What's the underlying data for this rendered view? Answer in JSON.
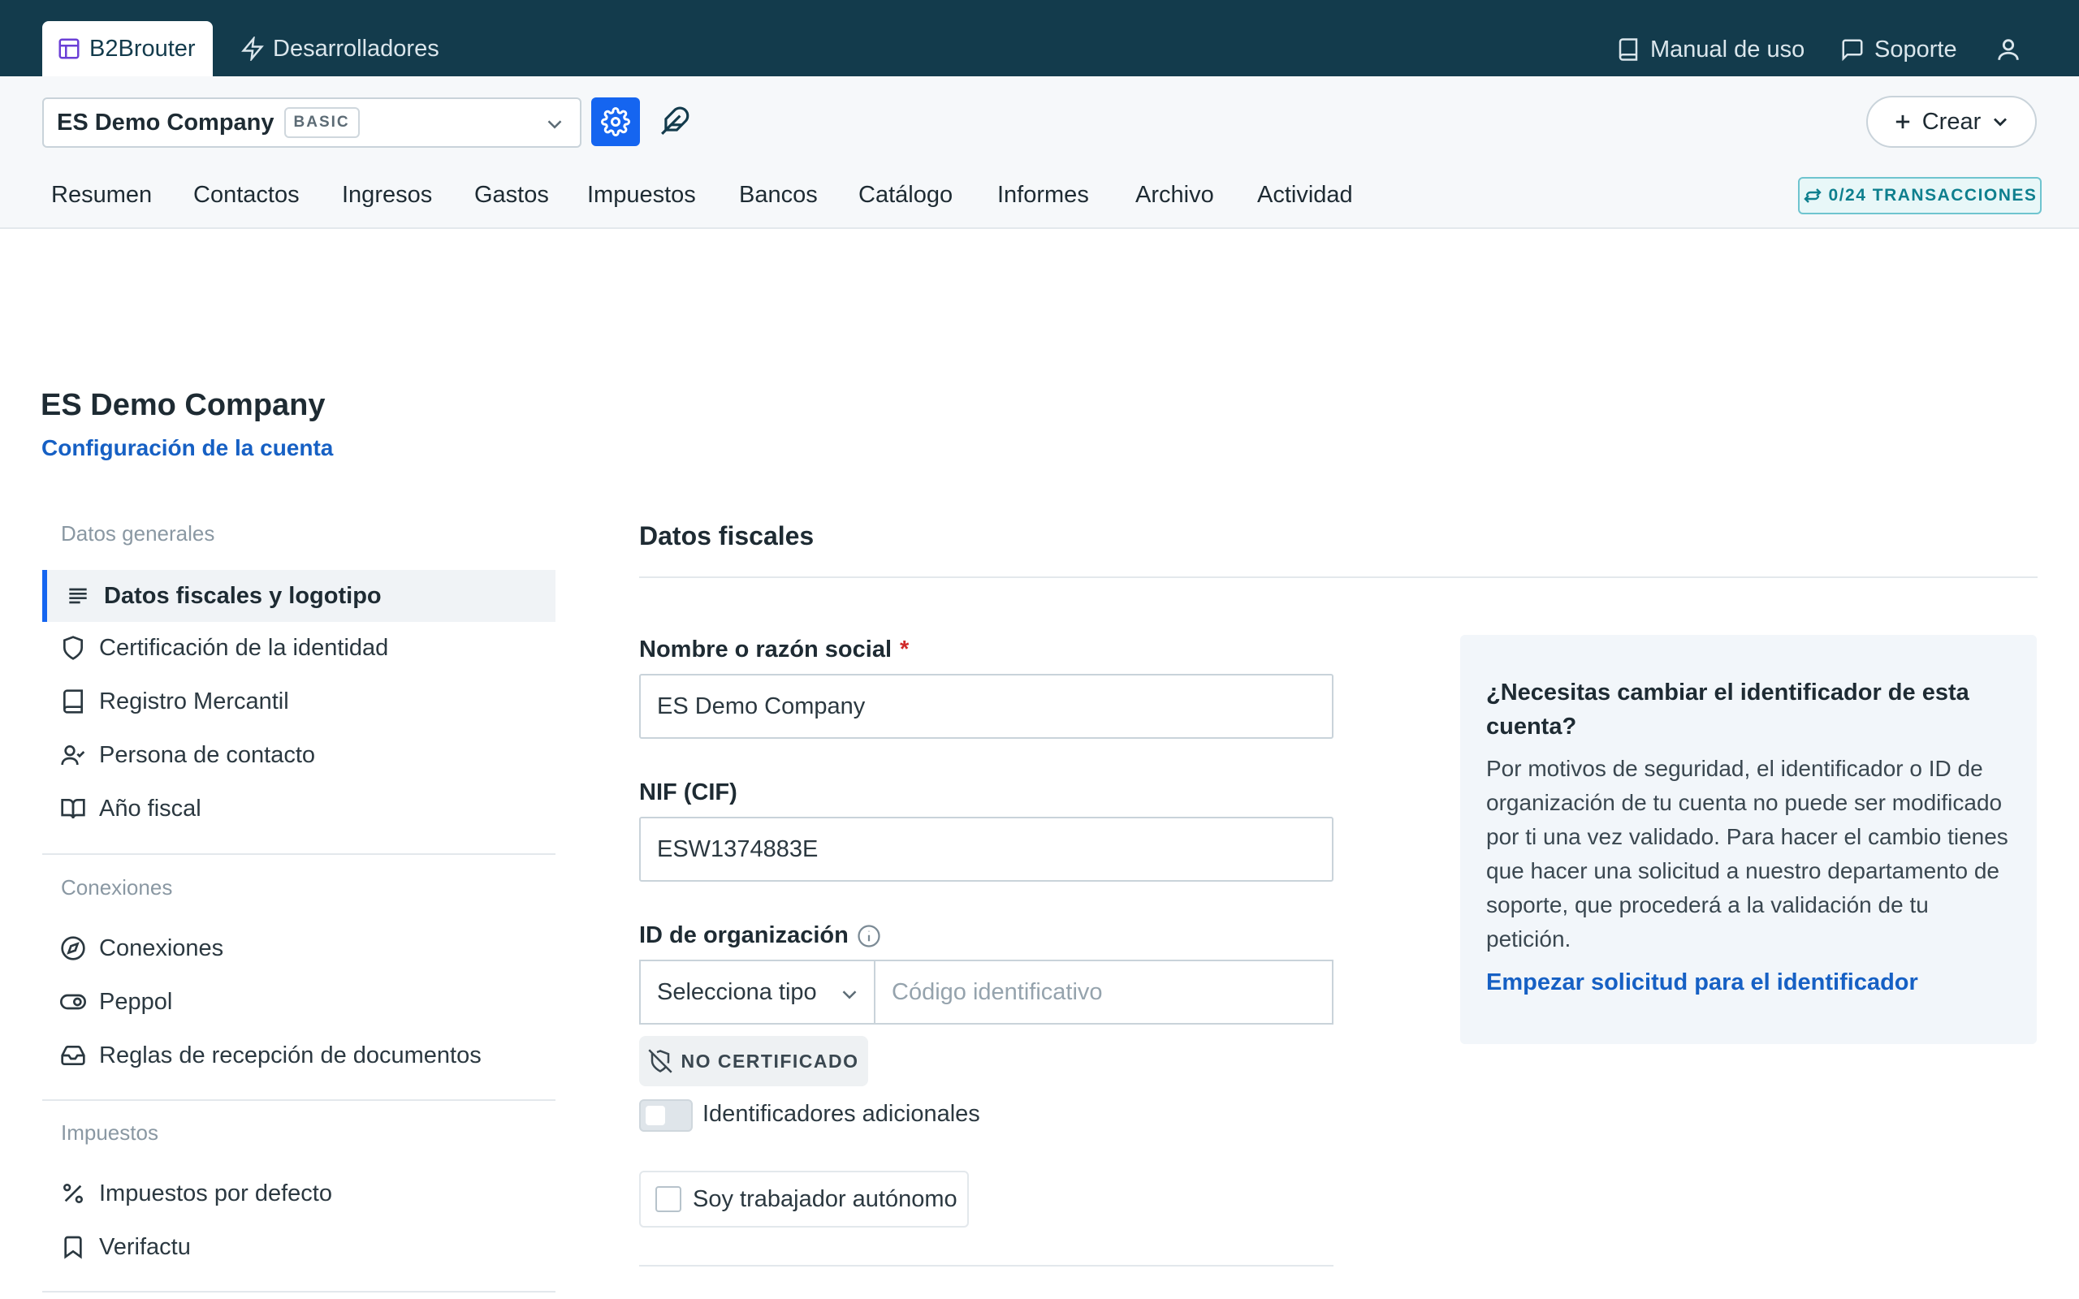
{
  "topbar": {
    "app_tab": "B2Brouter",
    "dev_tab": "Desarrolladores",
    "manual": "Manual de uso",
    "support": "Soporte"
  },
  "subbar": {
    "company_name": "ES Demo Company",
    "plan_badge": "BASIC",
    "crear_label": "Crear",
    "transactions_badge": "0/24 TRANSACCIONES",
    "nav": [
      "Resumen",
      "Contactos",
      "Ingresos",
      "Gastos",
      "Impuestos",
      "Bancos",
      "Catálogo",
      "Informes",
      "Archivo",
      "Actividad"
    ]
  },
  "page": {
    "title": "ES Demo Company",
    "subtitle": "Configuración de la cuenta"
  },
  "sidebar": {
    "sections": [
      {
        "heading": "Datos generales",
        "items": [
          {
            "label": "Datos fiscales y logotipo",
            "icon": "align-left-icon",
            "active": true
          },
          {
            "label": "Certificación de la identidad",
            "icon": "shield-icon"
          },
          {
            "label": "Registro Mercantil",
            "icon": "book-icon"
          },
          {
            "label": "Persona de contacto",
            "icon": "user-check-icon"
          },
          {
            "label": "Año fiscal",
            "icon": "book-open-icon"
          }
        ]
      },
      {
        "heading": "Conexiones",
        "items": [
          {
            "label": "Conexiones",
            "icon": "compass-icon"
          },
          {
            "label": "Peppol",
            "icon": "toggle-icon"
          },
          {
            "label": "Reglas de recepción de documentos",
            "icon": "inbox-icon"
          }
        ]
      },
      {
        "heading": "Impuestos",
        "items": [
          {
            "label": "Impuestos por defecto",
            "icon": "percent-icon"
          },
          {
            "label": "Verifactu",
            "icon": "bookmark-icon"
          }
        ]
      }
    ]
  },
  "form": {
    "section_title": "Datos fiscales",
    "name_label": "Nombre o razón social",
    "name_required": "*",
    "name_value": "ES Demo Company",
    "nif_label": "NIF (CIF)",
    "nif_value": "ESW1374883E",
    "org_label": "ID de organización",
    "org_type_value": "Selecciona tipo",
    "org_code_placeholder": "Código identificativo",
    "cert_badge": "NO CERTIFICADO",
    "additional_ids_label": "Identificadores adicionales",
    "additional_ids_on": false,
    "self_employed_label": "Soy trabajador autónomo",
    "self_employed_checked": false
  },
  "info_box": {
    "title": "¿Necesitas cambiar el identificador de esta cuenta?",
    "body": "Por motivos de seguridad, el identificador o ID de organización de tu cuenta no puede ser modificado por ti una vez validado. Para hacer el cambio tienes que hacer una solicitud a nuestro departamento de soporte, que procederá a la validación de tu petición.",
    "link": "Empezar solicitud para el identificador"
  },
  "colors": {
    "topbar": "#133b4c",
    "accent": "#1565f0",
    "link": "#1660c4",
    "required": "#d02929",
    "teal_badge": "#0e7f8e"
  }
}
